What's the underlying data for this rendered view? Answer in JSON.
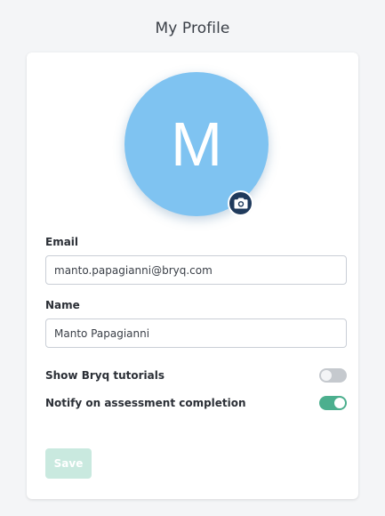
{
  "page": {
    "title": "My Profile"
  },
  "avatar": {
    "initial": "M",
    "color": "#7fc3f1",
    "camera_icon": "camera-icon"
  },
  "form": {
    "email_label": "Email",
    "email_value": "manto.papagianni@bryq.com",
    "name_label": "Name",
    "name_value": "Manto Papagianni"
  },
  "settings": {
    "tutorials_label": "Show Bryq tutorials",
    "tutorials_enabled": false,
    "notify_label": "Notify on assessment completion",
    "notify_enabled": true
  },
  "actions": {
    "save_label": "Save",
    "save_enabled": false
  },
  "colors": {
    "accent": "#4caf8e",
    "avatar": "#7fc3f1",
    "camera_button": "#1f3a5c",
    "save_disabled": "#c9e9df"
  }
}
